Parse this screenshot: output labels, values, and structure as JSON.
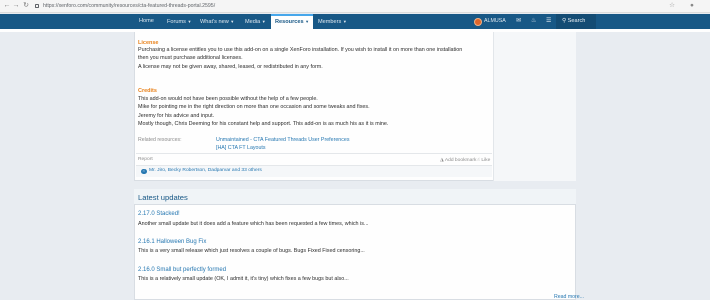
{
  "browser": {
    "url": "https://xenforo.com/community/resources/cta-featured-threads-portal.2595/",
    "back_icon": "arrow-left-icon",
    "forward_icon": "arrow-right-icon",
    "reload_icon": "reload-icon"
  },
  "nav": {
    "items": [
      {
        "label": "Home"
      },
      {
        "label": "Forums"
      },
      {
        "label": "What's new"
      },
      {
        "label": "Media"
      },
      {
        "label": "Resources"
      },
      {
        "label": "Members"
      }
    ],
    "user": "ALMUSA",
    "search": "Search"
  },
  "resource": {
    "license_title": "License",
    "license_lines": [
      "Purchasing a license entitles you to use this add-on on a single XenForo installation. If you wish to install it on more than one installation",
      "then you must purchase additional licenses.",
      "A license may not be given away, shared, leased, or redistributed in any form."
    ],
    "credits_title": "Credits",
    "credits_lines": [
      "This add-on would not have been possible without the help of a few people.",
      "Mike for pointing me in the right direction on more than one occasion and some tweaks and fixes.",
      "Jeremy for his advice and input.",
      "Mostly though, Chris Deeming for his constant help and support. This add-on is as much his as it is mine."
    ],
    "related_label": "Related resources:",
    "related": [
      "Unmaintained - CTA Featured Threads User Preferences",
      "[HA] CTA FT Layouts"
    ],
    "report": "Report",
    "bookmark": "Add bookmark",
    "like": "Like",
    "likes_text": "Mr. Jiro, Becky Robertson, Dadparvar and 33 others"
  },
  "updates": {
    "title": "Latest updates",
    "items": [
      {
        "title": "2.17.0 Stacked!",
        "text": "Another small update but it does add a feature which has been requested a few times, which is..."
      },
      {
        "title": "2.16.1 Halloween Bug Fix",
        "text": "This is a very small release which just resolves a couple of bugs. Bugs Fixed Fixed censoring..."
      },
      {
        "title": "2.16.0 Small but perfectly formed",
        "text": "This is a relatively small update (OK, I admit it, it's tiny) which fixes a few bugs but also..."
      }
    ],
    "read_more": "Read more..."
  }
}
